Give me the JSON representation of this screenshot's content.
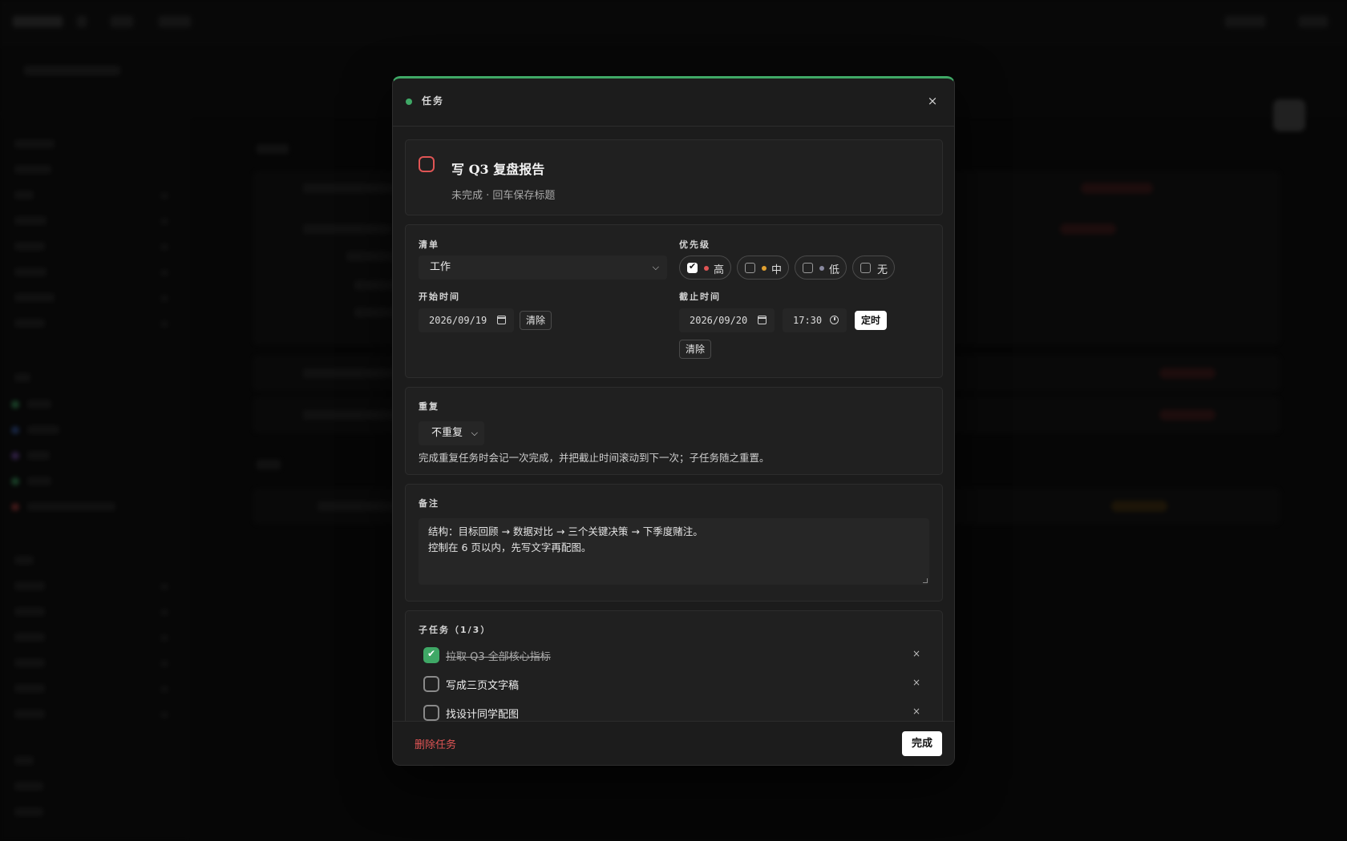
{
  "modal": {
    "header_title": "任务",
    "close_glyph": "×",
    "accent_color": "#3fa866"
  },
  "task": {
    "title": "写 Q3 复盘报告",
    "status_hint": "未完成 · 回车保存标题",
    "checkbox_color": "#e05555"
  },
  "meta": {
    "list_label": "清单",
    "list_value": "工作",
    "priority_label": "优先级",
    "priorities": [
      {
        "label": "高",
        "color": "#e05555",
        "selected": true
      },
      {
        "label": "中",
        "color": "#e0a030",
        "selected": false
      },
      {
        "label": "低",
        "color": "#8a8aa0",
        "selected": false
      },
      {
        "label": "无",
        "color": "",
        "selected": false
      }
    ],
    "start_label": "开始时间",
    "start_date": "2026/09/19",
    "start_clear": "清除",
    "due_label": "截止时间",
    "due_date": "2026/09/20",
    "due_time": "17:30",
    "due_timed": "定时",
    "due_clear": "清除"
  },
  "repeat": {
    "label": "重复",
    "value": "不重复",
    "note": "完成重复任务时会记一次完成，并把截止时间滚动到下一次；子任务随之重置。"
  },
  "notes": {
    "label": "备注",
    "line1": "结构：目标回顾 → 数据对比 → 三个关键决策 → 下季度赌注。",
    "line2": "控制在 6 页以内，先写文字再配图。"
  },
  "subtasks": {
    "label": "子任务（1/3）",
    "remove_glyph": "×",
    "items": [
      {
        "text": "拉取 Q3 全部核心指标",
        "done": true
      },
      {
        "text": "写成三页文字稿",
        "done": false
      },
      {
        "text": "找设计同学配图",
        "done": false
      }
    ]
  },
  "footer": {
    "delete_label": "删除任务",
    "done_label": "完成"
  }
}
